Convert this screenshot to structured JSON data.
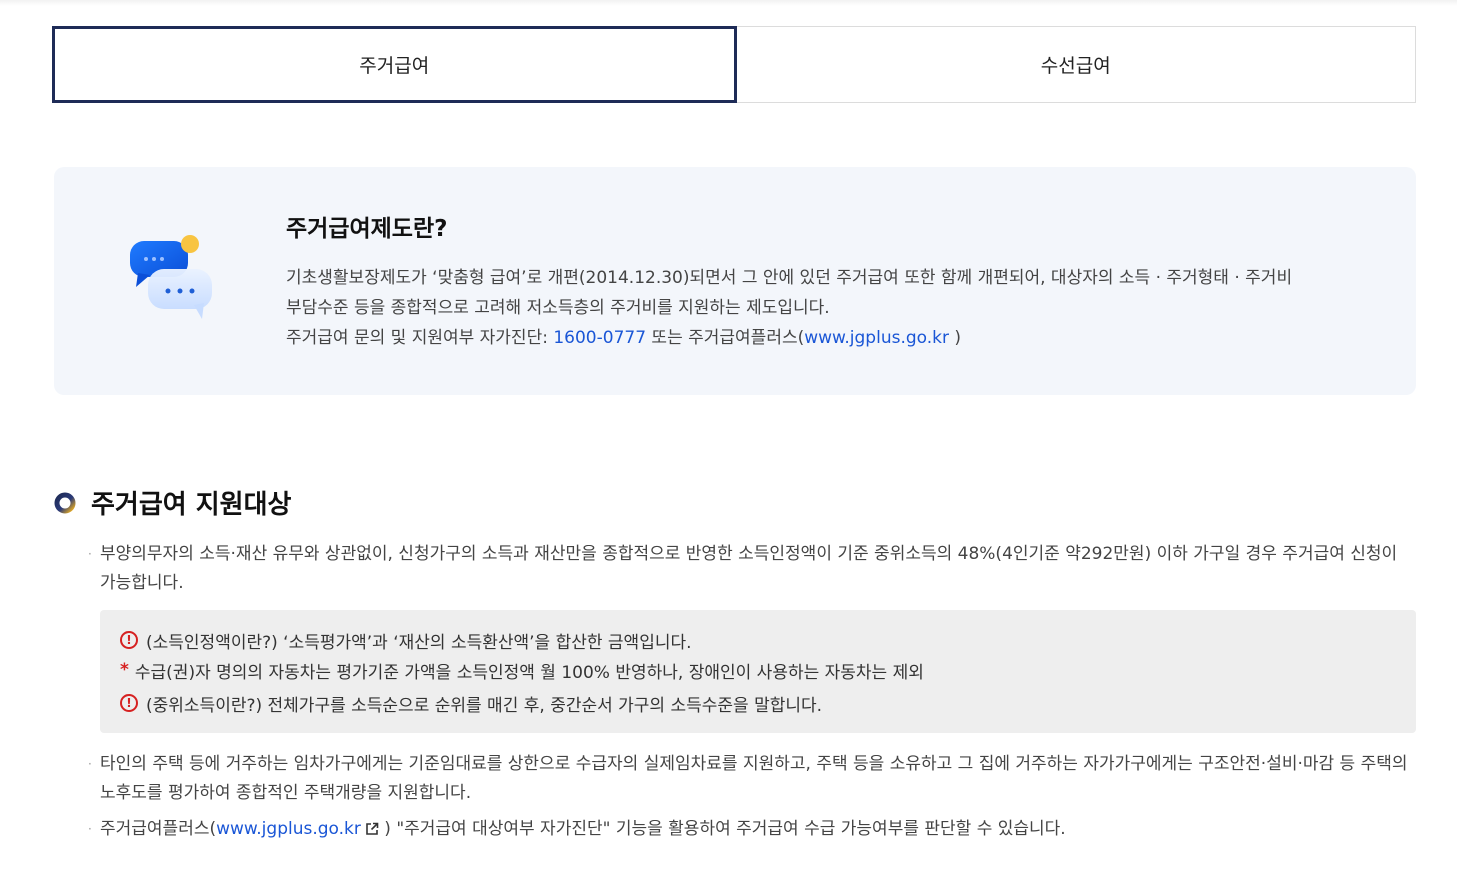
{
  "tabs": [
    {
      "label": "주거급여",
      "active": true
    },
    {
      "label": "수선급여",
      "active": false
    }
  ],
  "info": {
    "icon": "chat-bubbles-icon",
    "title": "주거급여제도란?",
    "line1": "기초생활보장제도가 ‘맞춤형 급여’로 개편(2014.12.30)되면서 그 안에 있던 주거급여 또한 함께 개편되어, 대상자의 소득 · 주거형태 · 주거비",
    "line2": "부담수준 등을 종합적으로 고려해 저소득층의 주거비를 지원하는 제도입니다.",
    "line3_prefix": "주거급여 문의 및 지원여부 자가진단: ",
    "phone": "1600-0777",
    "line3_mid": " 또는 주거급여플러스(",
    "site": "www.jgplus.go.kr",
    "line3_suffix": " )"
  },
  "section": {
    "icon": "ring-bullet-icon",
    "title": "주거급여 지원대상",
    "bullet1": "부양의무자의 소득·재산 유무와 상관없이, 신청가구의 소득과 재산만을 종합적으로 반영한 소득인정액이 기준 중위소득의 48%(4인기준 약292만원) 이하 가구일 경우 주거급여 신청이 가능합니다.",
    "notice": {
      "row1": "(소득인정액이란?) ‘소득평가액’과 ‘재산의 소득환산액’을 합산한 금액입니다.",
      "row2": "수급(권)자 명의의 자동차는 평가기준 가액을 소득인정액 월 100% 반영하나, 장애인이 사용하는 자동차는 제외",
      "row3": "(중위소득이란?) 전체가구를 소득순으로 순위를 매긴 후, 중간순서 가구의 소득수준을 말합니다.",
      "excl_mark": "!",
      "star_mark": "*"
    },
    "bullet2": "타인의 주택 등에 거주하는 임차가구에게는 기준임대료를 상한으로 수급자의 실제임차료를 지원하고, 주택 등을 소유하고 그 집에 거주하는 자가가구에게는 구조안전·설비·마감 등 주택의 노후도를 평가하여 종합적인 주택개량을 지원합니다.",
    "bullet3_prefix": "주거급여플러스(",
    "bullet3_link": "www.jgplus.go.kr",
    "bullet3_suffix": " ) \"주거급여 대상여부 자가진단\" 기능을 활용하여 주거급여 수급 가능여부를 판단할 수 있습니다.",
    "bullet_mark": "·"
  },
  "colors": {
    "tab_border": "#1e2b57",
    "link": "#1a56d6",
    "alert": "#d62121",
    "info_bg": "#f3f6fb"
  }
}
